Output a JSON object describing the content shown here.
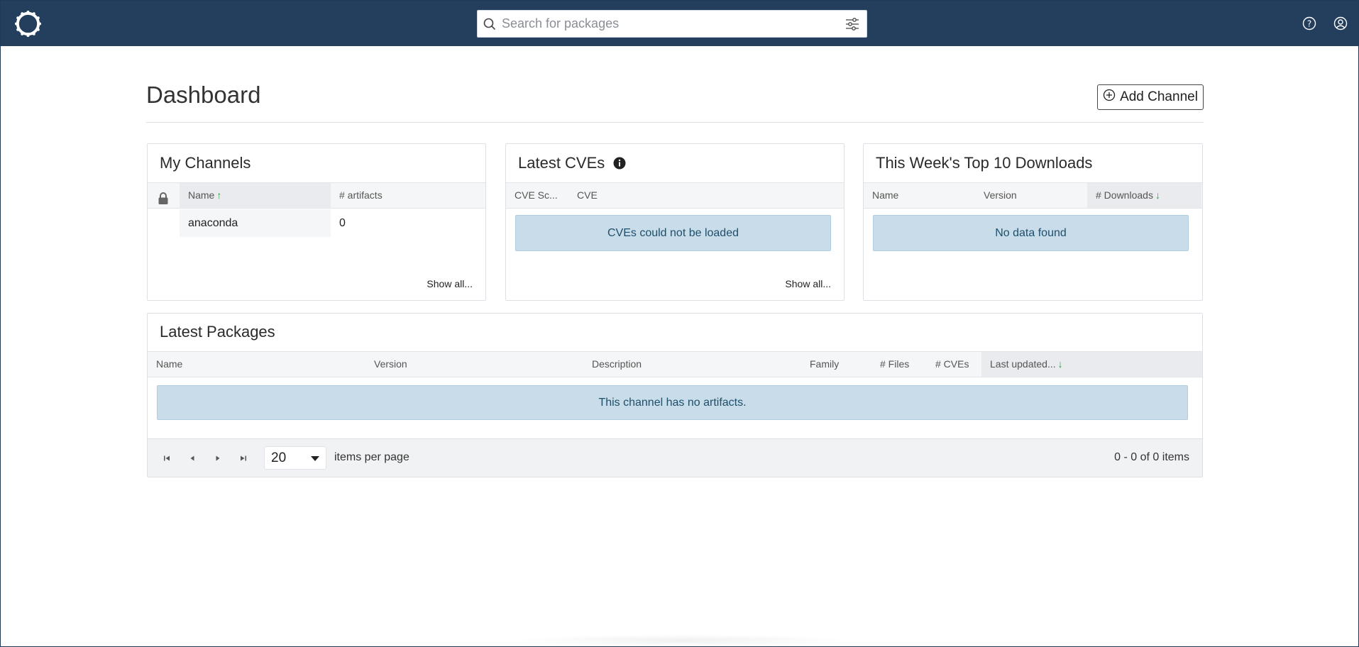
{
  "topbar": {
    "search_placeholder": "Search for packages",
    "logo_icon": "anaconda-logo-icon",
    "help_icon": "help-circle-icon",
    "user_icon": "user-circle-icon",
    "filter_icon": "sliders-icon"
  },
  "header": {
    "title": "Dashboard",
    "add_channel_label": "Add Channel"
  },
  "my_channels": {
    "title": "My Channels",
    "columns": {
      "lock": "",
      "name": "Name",
      "artifacts": "# artifacts"
    },
    "rows": [
      {
        "name": "anaconda",
        "artifacts": "0"
      }
    ],
    "show_all": "Show all..."
  },
  "latest_cves": {
    "title": "Latest CVEs",
    "columns": {
      "score": "CVE Sc...",
      "cve": "CVE"
    },
    "notice": "CVEs could not be loaded",
    "show_all": "Show all..."
  },
  "top_downloads": {
    "title": "This Week's Top 10 Downloads",
    "columns": {
      "name": "Name",
      "version": "Version",
      "downloads": "# Downloads"
    },
    "notice": "No data found"
  },
  "latest_packages": {
    "title": "Latest Packages",
    "columns": {
      "name": "Name",
      "version": "Version",
      "description": "Description",
      "family": "Family",
      "files": "# Files",
      "cves": "# CVEs",
      "last_updated": "Last updated..."
    },
    "notice": "This channel has no artifacts.",
    "pagination": {
      "per_page_value": "20",
      "per_page_label": "items per page",
      "info": "0 - 0 of 0 items"
    }
  },
  "colors": {
    "topbar": "#243f5e",
    "notice_bg": "#c8dde9",
    "sort_arrow": "#2ea043"
  }
}
